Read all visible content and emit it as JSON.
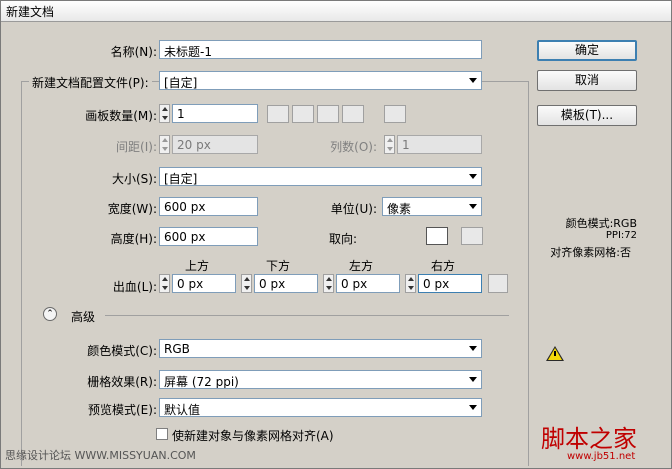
{
  "window": {
    "title": "新建文档"
  },
  "name": {
    "label": "名称(N):",
    "value": "未标题-1"
  },
  "profile": {
    "label": "新建文档配置文件(P):",
    "value": "[自定]"
  },
  "artboards": {
    "label": "画板数量(M):",
    "value": "1"
  },
  "spacing": {
    "label": "间距(I):",
    "value": "20 px"
  },
  "columns": {
    "label": "列数(O):",
    "value": "1"
  },
  "size": {
    "label": "大小(S):",
    "value": "[自定]"
  },
  "width": {
    "label": "宽度(W):",
    "value": "600 px"
  },
  "height": {
    "label": "高度(H):",
    "value": "600 px"
  },
  "units": {
    "label": "单位(U):",
    "value": "像素"
  },
  "orientation": {
    "label": "取向:"
  },
  "bleed": {
    "label": "出血(L):",
    "headers": [
      "上方",
      "下方",
      "左方",
      "右方"
    ],
    "values": [
      "0 px",
      "0 px",
      "0 px",
      "0 px"
    ]
  },
  "advanced": {
    "label": "高级",
    "color_mode": {
      "label": "颜色模式(C):",
      "value": "RGB"
    },
    "raster": {
      "label": "栅格效果(R):",
      "value": "屏幕 (72 ppi)"
    },
    "preview": {
      "label": "预览模式(E):",
      "value": "默认值"
    },
    "align_checkbox": "使新建对象与像素网格对齐(A)"
  },
  "buttons": {
    "ok": "确定",
    "cancel": "取消",
    "templates": "模板(T)..."
  },
  "info": {
    "color_mode": "颜色模式:RGB",
    "ppi": "PPI:72",
    "align": "对齐像素网格:否"
  },
  "watermark": {
    "left": "思缘设计论坛 WWW.MISSYUAN.COM",
    "right": "脚本之家",
    "url": "www.jb51.net"
  }
}
